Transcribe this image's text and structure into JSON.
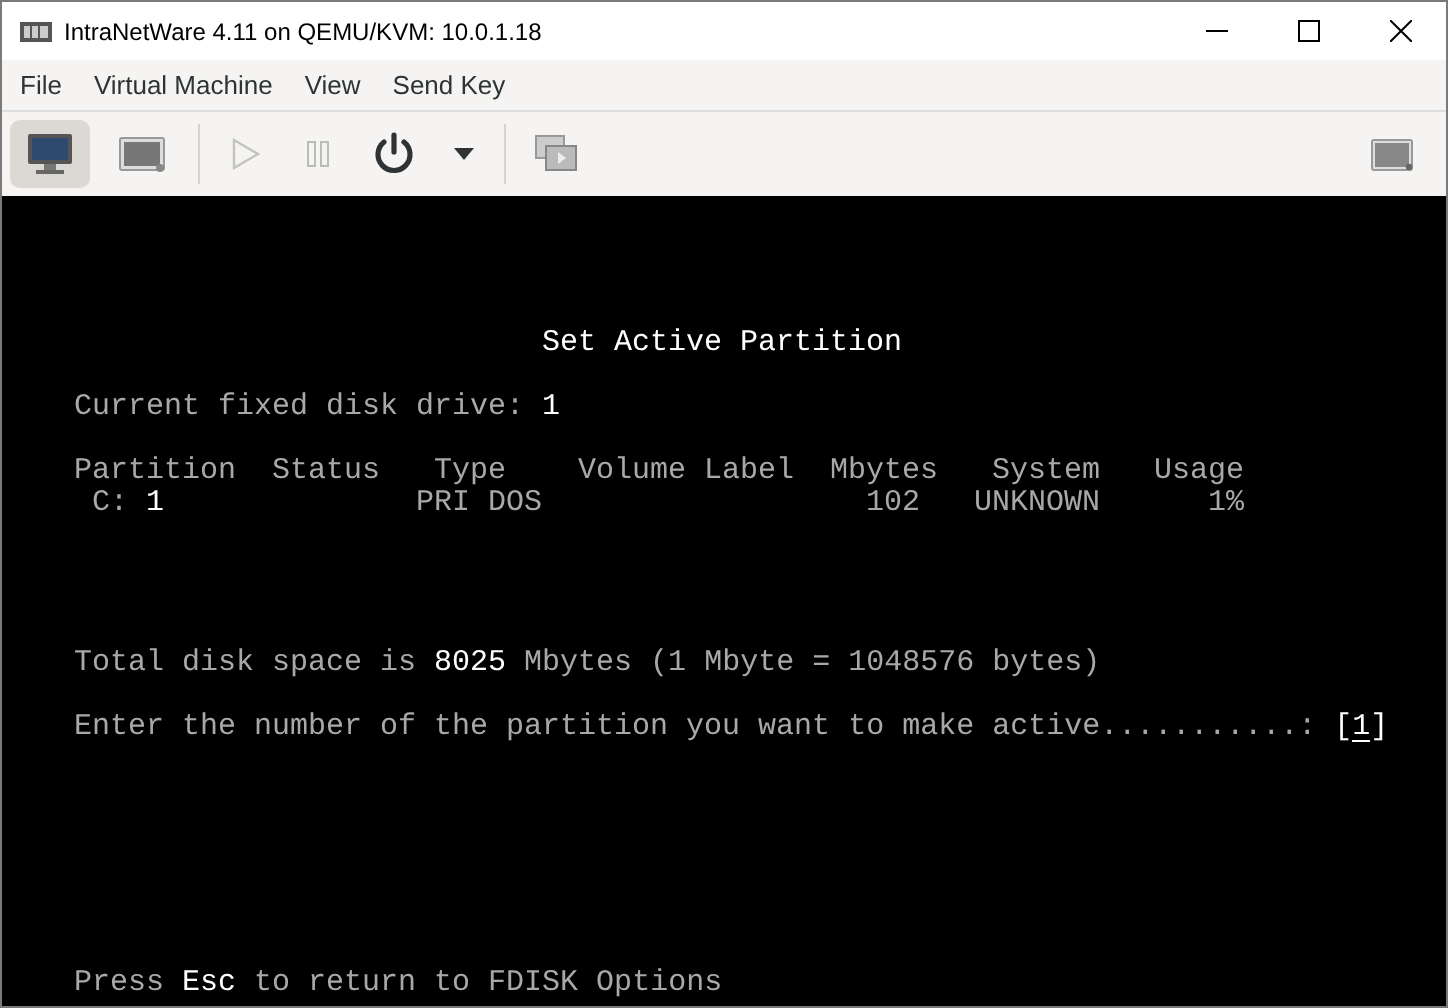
{
  "window": {
    "title": "IntraNetWare 4.11 on QEMU/KVM: 10.0.1.18"
  },
  "menu": [
    "File",
    "Virtual Machine",
    "View",
    "Send Key"
  ],
  "toolbar": [
    {
      "kind": "console",
      "selected": true,
      "disabled": false
    },
    {
      "kind": "details",
      "selected": false,
      "disabled": false
    },
    {
      "kind": "separator"
    },
    {
      "kind": "run",
      "selected": false,
      "disabled": true
    },
    {
      "kind": "pause",
      "selected": false,
      "disabled": true
    },
    {
      "kind": "power",
      "selected": false,
      "disabled": false
    },
    {
      "kind": "power-menu",
      "selected": false,
      "disabled": false
    },
    {
      "kind": "separator"
    },
    {
      "kind": "snapshots",
      "selected": false,
      "disabled": false
    },
    {
      "kind": "spacer"
    },
    {
      "kind": "fullscreen",
      "selected": false,
      "disabled": false
    }
  ],
  "console": {
    "title": "Set Active Partition",
    "drive_line": "Current fixed disk drive: **1**",
    "table": {
      "columns": [
        "Partition",
        "Status",
        "Type",
        "Volume Label",
        "Mbytes",
        "System",
        "Usage"
      ],
      "rows": [
        {
          "cells": [
            "C: **1**",
            null,
            "PRI DOS",
            null,
            "102",
            "UNKNOWN",
            "1%"
          ]
        }
      ]
    },
    "total_line": "Total disk space is **8025** Mbytes (1 Mbyte = 1048576 bytes)",
    "prompt": "Enter the number of the partition you want to make active...........:",
    "answer": "[1]",
    "footer": "Press **Esc** to return to FDISK Options"
  }
}
